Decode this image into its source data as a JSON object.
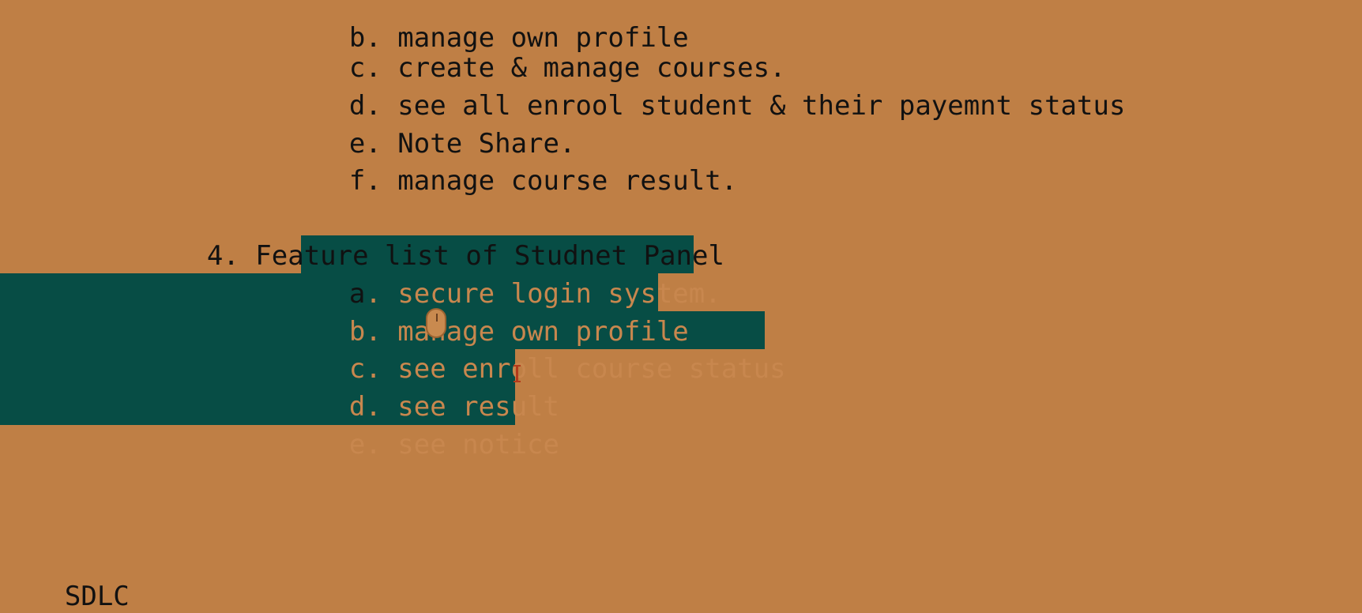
{
  "document": {
    "lines": {
      "top_partial": "b. manage own profile",
      "c1": "c. create & manage courses.",
      "d1": "d. see all enrool student & their payemnt status",
      "e1": "e. Note Share.",
      "f1": "f. manage course result.",
      "heading": "4. Feature list of Studnet Panel",
      "a2_prefix": "a",
      "a2_rest": ". secure login system.",
      "b2": "b. manage own profile",
      "c2": "c. see enroll course status",
      "d2": "d. see result",
      "e2": "e. see notice",
      "sdlc": "SDLC"
    }
  },
  "colors": {
    "background": "#bf7f45",
    "selection": "#074d45",
    "text": "#111111",
    "selected_text": "#c8874e"
  },
  "icons": {
    "mouse": "mouse-icon",
    "cursor": "i-beam-cursor-icon"
  }
}
